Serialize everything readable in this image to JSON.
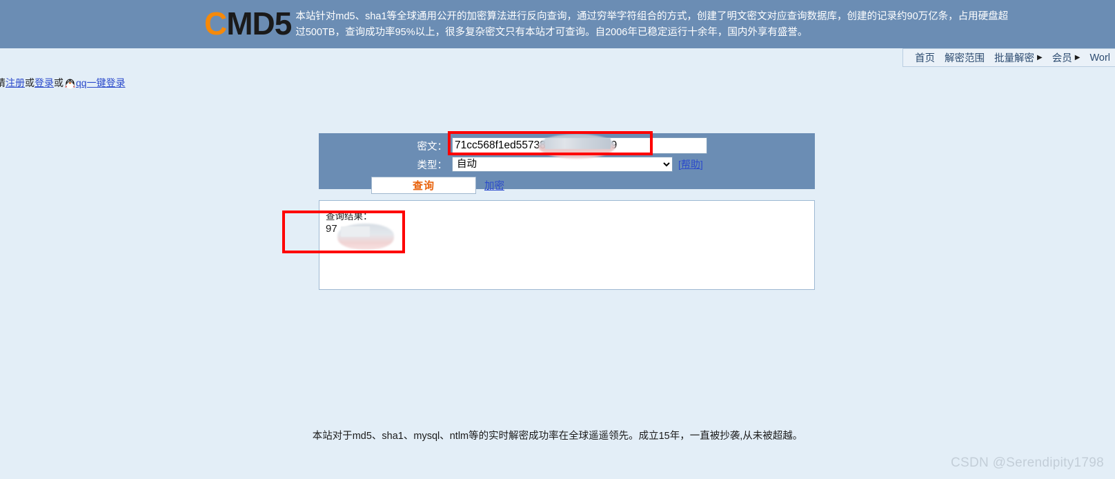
{
  "header": {
    "logo_c": "C",
    "logo_rest": "MD5",
    "desc_line1": "本站针对md5、sha1等全球通用公开的加密算法进行反向查询，通过穷举字符组合的方式，创建了明文密文对应查询数据库，创建的记录约90万亿条，占用硬盘超",
    "desc_line2": "过500TB，查询成功率95%以上，很多复杂密文只有本站才可查询。自2006年已稳定运行十余年，国内外享有盛誉。"
  },
  "nav": {
    "items": [
      {
        "label": "首页",
        "has_caret": false
      },
      {
        "label": "解密范围",
        "has_caret": false
      },
      {
        "label": "批量解密",
        "has_caret": true
      },
      {
        "label": "会员",
        "has_caret": true
      },
      {
        "label": "Worl",
        "has_caret": false
      }
    ]
  },
  "login_bar": {
    "prefix": "请",
    "register": "注册",
    "or1": "或",
    "login": "登录",
    "or2": "或",
    "qq_login": "qq一键登录",
    "qq_icon": "qq-penguin-icon"
  },
  "form": {
    "ciphertext_label": "密文：",
    "ciphertext_value": "71cc568f1ed55738                d8d9",
    "type_label": "类型：",
    "type_value": "自动",
    "type_options": [
      "自动"
    ],
    "help_label": "[帮助]",
    "submit_label": "查询",
    "encrypt_label": "加密"
  },
  "result": {
    "title": "查询结果：",
    "value": "97"
  },
  "footer": {
    "text": "本站对于md5、sha1、mysql、ntlm等的实时解密成功率在全球遥遥领先。成立15年，一直被抄袭,从未被超越。"
  },
  "watermark": {
    "text": "CSDN @Serendipity1798"
  },
  "colors": {
    "header_bg": "#6b8db4",
    "page_bg": "#e3eef7",
    "accent_orange": "#f5890a",
    "button_text": "#e8620c",
    "link_blue": "#2b4acb",
    "highlight_red": "#fe0000"
  }
}
